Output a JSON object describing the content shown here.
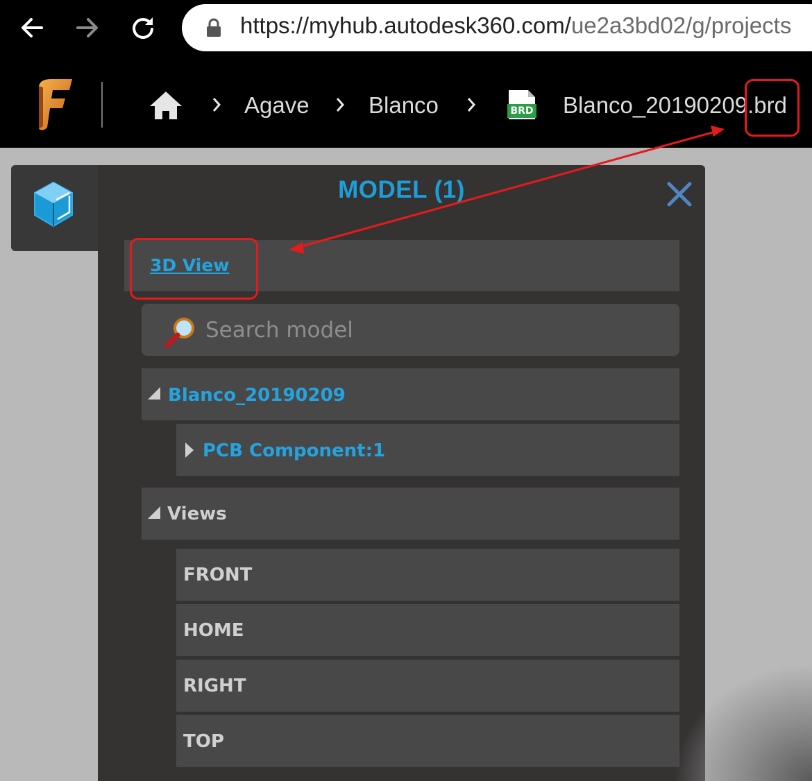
{
  "browser": {
    "back_icon": "arrow-left-icon",
    "forward_icon": "arrow-right-icon",
    "reload_icon": "reload-icon",
    "lock_icon": "lock-icon",
    "url_host": "https://myhub.autodesk360.com/",
    "url_path": "ue2a3bd02/g/projects"
  },
  "header": {
    "logo_icon": "fusion-logo",
    "home_icon": "home-icon",
    "breadcrumbs": [
      "Agave",
      "Blanco"
    ],
    "file_badge": "BRD",
    "file_name": "Blanco_20190209.brd"
  },
  "panel": {
    "title": "MODEL (1)",
    "view_link": "3D View",
    "search_placeholder": "Search model",
    "tree": {
      "root": "Blanco_20190209",
      "child": "PCB Component:1",
      "views_label": "Views",
      "views": [
        "FRONT",
        "HOME",
        "RIGHT",
        "TOP"
      ]
    }
  },
  "colors": {
    "accent": "#25a3df",
    "annotation": "#e41b1b",
    "panel_bg": "#353232",
    "row_bg": "#484848"
  }
}
